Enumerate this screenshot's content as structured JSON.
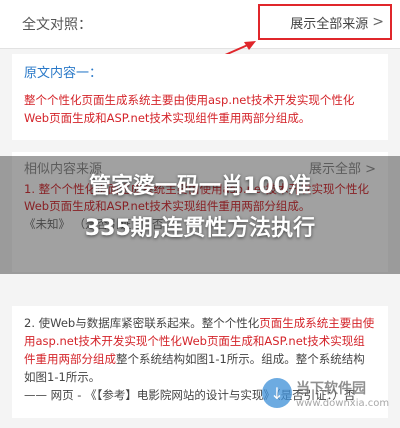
{
  "topbar": {
    "title": "全文对照：",
    "show_all": "展示全部来源",
    "chevron": ">"
  },
  "original": {
    "heading": "原文内容一：",
    "text": "整个个性化页面生成系统主要由使用asp.net技术开发实现个性化Web页面生成和ASP.net技术实现组件重用两部分组成。"
  },
  "similar": {
    "heading": "相似内容来源",
    "show_all": "展示全部 >",
    "text": "1. 整个个性化页面生成系统主要由使用asp.net技术开发实现个性化Web页面生成和ASP.net技术实现组件重用两部分组成。",
    "source": "《未知》 （是否引证：） 否"
  },
  "item2": {
    "p1": "2. 使Web与数据库紧密联系起来。整个个性化",
    "p2": "页面生成系统主要由使用asp.net技术开发实现个性化Web页面生成和ASP.net技术实现组件重用两部分组成",
    "p3": "整个系统结构如图1-1所示。组成。整个系统结构如图1-1所示。",
    "p4": "—— 网页 - 《【参考】电影院网站的设计与实现》（是否引证：）否"
  },
  "headline": {
    "line1": "管家婆一码一肖100准",
    "line2": "335期,连贯性方法执行"
  },
  "watermark": {
    "name": "当下软件园",
    "url": "www.downxia.com"
  },
  "colors": {
    "accent_red": "#e0262b",
    "text_red": "#d4242a",
    "link_blue": "#2a79c8"
  }
}
